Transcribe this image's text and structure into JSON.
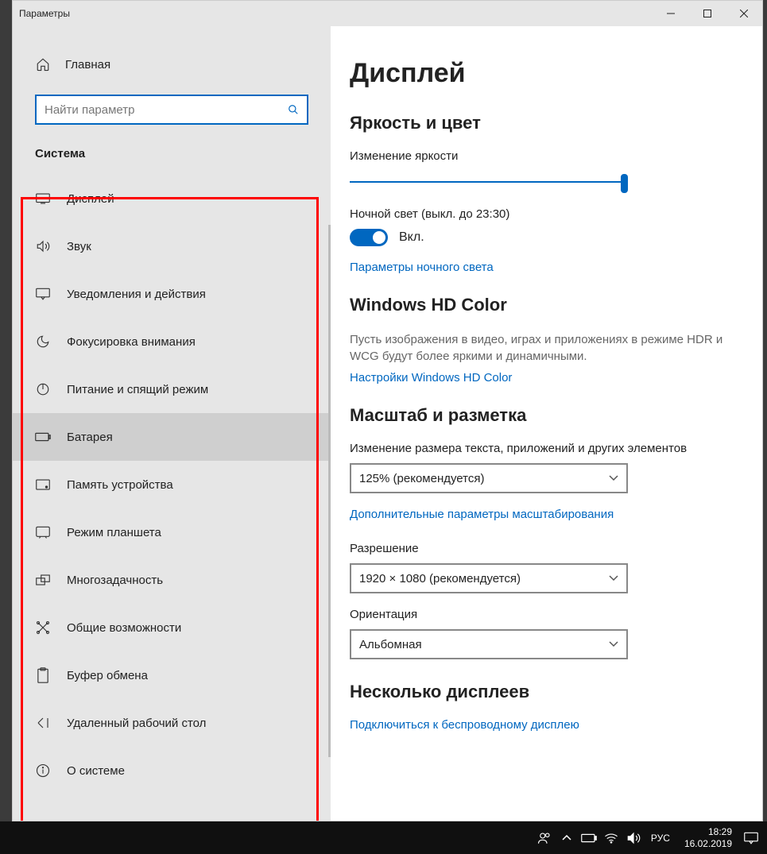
{
  "window": {
    "title": "Параметры"
  },
  "sidebar": {
    "home": "Главная",
    "search_placeholder": "Найти параметр",
    "category": "Система",
    "items": [
      {
        "label": "Дисплей"
      },
      {
        "label": "Звук"
      },
      {
        "label": "Уведомления и действия"
      },
      {
        "label": "Фокусировка внимания"
      },
      {
        "label": "Питание и спящий режим"
      },
      {
        "label": "Батарея"
      },
      {
        "label": "Память устройства"
      },
      {
        "label": "Режим планшета"
      },
      {
        "label": "Многозадачность"
      },
      {
        "label": "Общие возможности"
      },
      {
        "label": "Буфер обмена"
      },
      {
        "label": "Удаленный рабочий стол"
      },
      {
        "label": "О системе"
      }
    ]
  },
  "content": {
    "heading": "Дисплей",
    "brightness": {
      "heading": "Яркость и цвет",
      "slider_label": "Изменение яркости",
      "nightlight_label": "Ночной свет (выкл. до 23:30)",
      "toggle_state": "Вкл.",
      "nightlight_link": "Параметры ночного света"
    },
    "hdcolor": {
      "heading": "Windows HD Color",
      "desc": "Пусть изображения в видео, играх и приложениях в режиме HDR и WCG будут более яркими и динамичными.",
      "link": "Настройки Windows HD Color"
    },
    "scale": {
      "heading": "Масштаб и разметка",
      "scale_label": "Изменение размера текста, приложений и других элементов",
      "scale_value": "125% (рекомендуется)",
      "scale_link": "Дополнительные параметры масштабирования",
      "resolution_label": "Разрешение",
      "resolution_value": "1920 × 1080 (рекомендуется)",
      "orientation_label": "Ориентация",
      "orientation_value": "Альбомная"
    },
    "multimon": {
      "heading": "Несколько дисплеев",
      "link": "Подключиться к беспроводному дисплею"
    }
  },
  "taskbar": {
    "lang": "РУС",
    "time": "18:29",
    "date": "16.02.2019"
  }
}
